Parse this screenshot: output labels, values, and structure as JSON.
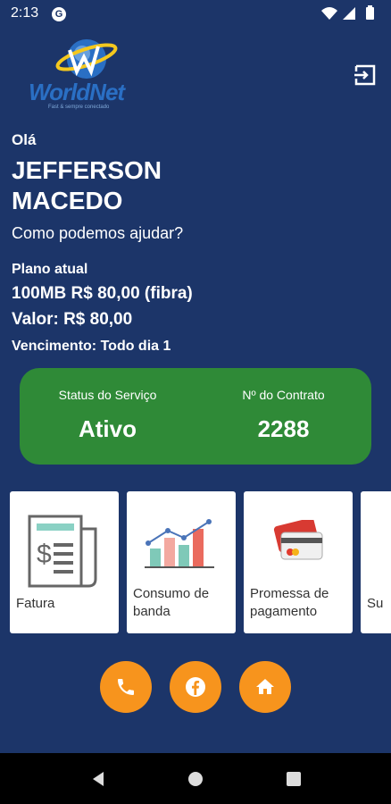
{
  "status_bar": {
    "time": "2:13",
    "app_badge": "G"
  },
  "brand": {
    "name": "WorldNet",
    "tagline": "Fast & sempre conectado"
  },
  "greeting": "Olá",
  "user_name": "JEFFERSON MACEDO",
  "help_prompt": "Como podemos ajudar?",
  "plan": {
    "label": "Plano atual",
    "name": "100MB R$ 80,00 (fibra)",
    "value": "Valor: R$ 80,00",
    "due": "Vencimento: Todo dia 1"
  },
  "service": {
    "status_label": "Status do Serviço",
    "status_value": "Ativo",
    "contract_label": "Nº do Contrato",
    "contract_value": "2288"
  },
  "tiles": [
    {
      "label": "Fatura",
      "icon": "invoice-icon"
    },
    {
      "label": "Consumo de banda",
      "icon": "bar-chart-icon"
    },
    {
      "label": "Promessa de pagamento",
      "icon": "credit-card-icon"
    },
    {
      "label": "Su",
      "icon": "support-icon"
    }
  ],
  "actions": [
    {
      "icon": "phone-icon"
    },
    {
      "icon": "facebook-icon"
    },
    {
      "icon": "home-icon"
    }
  ],
  "colors": {
    "background": "#1c3569",
    "status_card": "#2f8a37",
    "fab": "#f7941d"
  }
}
